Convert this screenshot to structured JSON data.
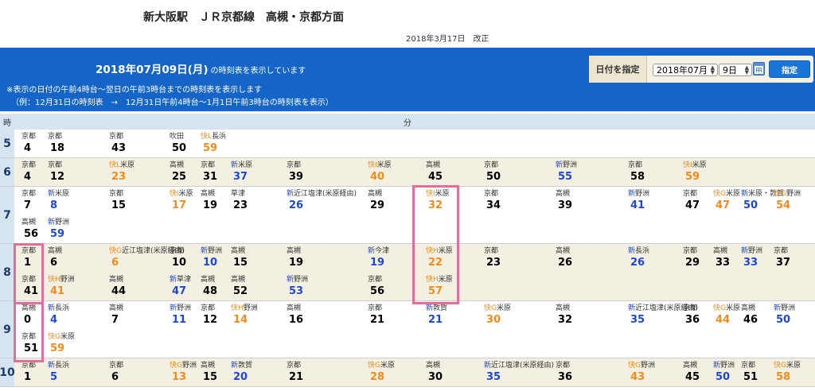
{
  "header": {
    "title": "新大阪駅　ＪＲ京都線　高槻・京都方面",
    "revised": "2018年3月17日　改正"
  },
  "banner": {
    "date_main": "2018年07月09日(月)",
    "date_suffix": "の時刻表を表示しています",
    "note1": "※表示の日付の午前4時台〜翌日の午前3時台までの時刻表を表示します",
    "note2": "（例：12月31日の時刻表　→　12月31日午前4時台〜1月1日午前3時台の時刻表を表示）"
  },
  "date_picker": {
    "label": "日付を指定",
    "month_value": "2018年07月",
    "day_value": "9日",
    "submit_label": "指定"
  },
  "table_header": {
    "hour": "時",
    "minute": "分"
  },
  "colors": {
    "banner_blue": "#1565c8",
    "rapid_orange": "#f08c1e",
    "new_rapid_blue": "#1e46d8",
    "highlight_pink": "#e0709a"
  },
  "timetable": [
    {
      "hour": "5",
      "trains": [
        {
          "pre": "",
          "dest": "京都",
          "min": "4",
          "type": "local"
        },
        {
          "pre": "",
          "dest": "京都",
          "min": "18",
          "type": "local"
        },
        {
          "pre": "",
          "dest": "京都",
          "min": "43",
          "type": "local"
        },
        {
          "pre": "",
          "dest": "吹田",
          "min": "50",
          "type": "local"
        },
        {
          "pre": "快L",
          "dest": "長浜",
          "min": "59",
          "type": "rapid"
        }
      ]
    },
    {
      "hour": "6",
      "trains": [
        {
          "pre": "",
          "dest": "京都",
          "min": "4",
          "type": "local"
        },
        {
          "pre": "",
          "dest": "京都",
          "min": "12",
          "type": "local"
        },
        {
          "pre": "快L",
          "dest": "米原",
          "min": "23",
          "type": "rapid"
        },
        {
          "pre": "",
          "dest": "高槻",
          "min": "25",
          "type": "local"
        },
        {
          "pre": "",
          "dest": "京都",
          "min": "31",
          "type": "local"
        },
        {
          "pre": "新",
          "dest": "米原",
          "min": "37",
          "type": "new"
        },
        {
          "pre": "",
          "dest": "京都",
          "min": "39",
          "type": "local"
        },
        {
          "pre": "快I",
          "dest": "米原",
          "min": "40",
          "type": "rapid"
        },
        {
          "pre": "",
          "dest": "高槻",
          "min": "45",
          "type": "local"
        },
        {
          "pre": "",
          "dest": "京都",
          "min": "50",
          "type": "local"
        },
        {
          "pre": "新",
          "dest": "野洲",
          "min": "55",
          "type": "new"
        },
        {
          "pre": "",
          "dest": "京都",
          "min": "58",
          "type": "local"
        },
        {
          "pre": "快I",
          "dest": "米原",
          "min": "59",
          "type": "rapid"
        }
      ]
    },
    {
      "hour": "7",
      "trains": [
        {
          "pre": "",
          "dest": "京都",
          "min": "7",
          "type": "local"
        },
        {
          "pre": "新",
          "dest": "米原",
          "min": "8",
          "type": "new"
        },
        {
          "pre": "",
          "dest": "京都",
          "min": "15",
          "type": "local"
        },
        {
          "pre": "快I",
          "dest": "米原",
          "min": "17",
          "type": "rapid"
        },
        {
          "pre": "",
          "dest": "高槻",
          "min": "19",
          "type": "local"
        },
        {
          "pre": "",
          "dest": "草津",
          "min": "23",
          "type": "local"
        },
        {
          "pre": "新",
          "dest": "近江塩津(米原経由)",
          "min": "26",
          "type": "new"
        },
        {
          "pre": "",
          "dest": "高槻",
          "min": "29",
          "type": "local"
        },
        {
          "pre": "快I",
          "dest": "米原",
          "min": "32",
          "type": "rapid"
        },
        {
          "pre": "",
          "dest": "京都",
          "min": "34",
          "type": "local"
        },
        {
          "pre": "",
          "dest": "高槻",
          "min": "39",
          "type": "local"
        },
        {
          "pre": "新",
          "dest": "野洲",
          "min": "41",
          "type": "new"
        },
        {
          "pre": "",
          "dest": "京都",
          "min": "47",
          "type": "local"
        },
        {
          "pre": "快G",
          "dest": "米原",
          "min": "47",
          "type": "rapid"
        },
        {
          "pre": "新",
          "dest": "米原・敦賀",
          "min": "50",
          "type": "new"
        },
        {
          "pre": "快G",
          "dest": "野洲",
          "min": "54",
          "type": "rapid"
        },
        {
          "pre": "",
          "dest": "高槻",
          "min": "56",
          "type": "local"
        },
        {
          "pre": "新",
          "dest": "野洲",
          "min": "59",
          "type": "new"
        }
      ]
    },
    {
      "hour": "8",
      "trains": [
        {
          "pre": "",
          "dest": "京都",
          "min": "1",
          "type": "local"
        },
        {
          "pre": "",
          "dest": "高槻",
          "min": "6",
          "type": "local"
        },
        {
          "pre": "快G",
          "dest": "近江塩津(米原経由)",
          "min": "6",
          "type": "rapid"
        },
        {
          "pre": "",
          "dest": "京都",
          "min": "10",
          "type": "local"
        },
        {
          "pre": "新",
          "dest": "野洲",
          "min": "10",
          "type": "new"
        },
        {
          "pre": "",
          "dest": "高槻",
          "min": "15",
          "type": "local"
        },
        {
          "pre": "",
          "dest": "高槻",
          "min": "19",
          "type": "local"
        },
        {
          "pre": "新",
          "dest": "今津",
          "min": "19",
          "type": "new"
        },
        {
          "pre": "快H",
          "dest": "米原",
          "min": "22",
          "type": "rapid"
        },
        {
          "pre": "",
          "dest": "京都",
          "min": "23",
          "type": "local"
        },
        {
          "pre": "",
          "dest": "高槻",
          "min": "26",
          "type": "local"
        },
        {
          "pre": "新",
          "dest": "長浜",
          "min": "26",
          "type": "new"
        },
        {
          "pre": "",
          "dest": "京都",
          "min": "29",
          "type": "local"
        },
        {
          "pre": "",
          "dest": "高槻",
          "min": "33",
          "type": "local"
        },
        {
          "pre": "新",
          "dest": "野洲",
          "min": "33",
          "type": "new"
        },
        {
          "pre": "",
          "dest": "京都",
          "min": "37",
          "type": "local"
        },
        {
          "pre": "",
          "dest": "京都",
          "min": "41",
          "type": "local"
        },
        {
          "pre": "快H",
          "dest": "野洲",
          "min": "41",
          "type": "rapid"
        },
        {
          "pre": "",
          "dest": "高槻",
          "min": "44",
          "type": "local"
        },
        {
          "pre": "新",
          "dest": "草津",
          "min": "47",
          "type": "new"
        },
        {
          "pre": "",
          "dest": "高槻",
          "min": "48",
          "type": "local"
        },
        {
          "pre": "",
          "dest": "高槻",
          "min": "52",
          "type": "local"
        },
        {
          "pre": "新",
          "dest": "野洲",
          "min": "53",
          "type": "new"
        },
        {
          "pre": "",
          "dest": "京都",
          "min": "56",
          "type": "local"
        },
        {
          "pre": "快H",
          "dest": "米原",
          "min": "57",
          "type": "rapid"
        }
      ]
    },
    {
      "hour": "9",
      "trains": [
        {
          "pre": "",
          "dest": "高槻",
          "min": "0",
          "type": "local"
        },
        {
          "pre": "新",
          "dest": "長浜",
          "min": "4",
          "type": "new"
        },
        {
          "pre": "",
          "dest": "高槻",
          "min": "7",
          "type": "local"
        },
        {
          "pre": "新",
          "dest": "野洲",
          "min": "11",
          "type": "new"
        },
        {
          "pre": "",
          "dest": "京都",
          "min": "12",
          "type": "local"
        },
        {
          "pre": "快H",
          "dest": "野洲",
          "min": "14",
          "type": "rapid"
        },
        {
          "pre": "",
          "dest": "高槻",
          "min": "16",
          "type": "local"
        },
        {
          "pre": "",
          "dest": "京都",
          "min": "21",
          "type": "local"
        },
        {
          "pre": "新",
          "dest": "敦賀",
          "min": "21",
          "type": "new"
        },
        {
          "pre": "快G",
          "dest": "米原",
          "min": "30",
          "type": "rapid"
        },
        {
          "pre": "",
          "dest": "高槻",
          "min": "32",
          "type": "local"
        },
        {
          "pre": "新",
          "dest": "近江塩津(米原経由)",
          "min": "35",
          "type": "new"
        },
        {
          "pre": "",
          "dest": "京都",
          "min": "36",
          "type": "local"
        },
        {
          "pre": "快G",
          "dest": "米原",
          "min": "44",
          "type": "rapid"
        },
        {
          "pre": "",
          "dest": "高槻",
          "min": "46",
          "type": "local"
        },
        {
          "pre": "新",
          "dest": "野洲",
          "min": "50",
          "type": "new"
        },
        {
          "pre": "",
          "dest": "京都",
          "min": "51",
          "type": "local"
        },
        {
          "pre": "快G",
          "dest": "米原",
          "min": "59",
          "type": "rapid"
        }
      ]
    },
    {
      "hour": "10",
      "trains": [
        {
          "pre": "",
          "dest": "京都",
          "min": "1",
          "type": "local"
        },
        {
          "pre": "新",
          "dest": "長浜",
          "min": "5",
          "type": "new"
        },
        {
          "pre": "",
          "dest": "京都",
          "min": "6",
          "type": "local"
        },
        {
          "pre": "快G",
          "dest": "野洲",
          "min": "13",
          "type": "rapid"
        },
        {
          "pre": "",
          "dest": "高槻",
          "min": "15",
          "type": "local"
        },
        {
          "pre": "新",
          "dest": "敦賀",
          "min": "20",
          "type": "new"
        },
        {
          "pre": "",
          "dest": "京都",
          "min": "21",
          "type": "local"
        },
        {
          "pre": "快G",
          "dest": "米原",
          "min": "28",
          "type": "rapid"
        },
        {
          "pre": "",
          "dest": "高槻",
          "min": "30",
          "type": "local"
        },
        {
          "pre": "新",
          "dest": "近江塩津(米原経由)",
          "min": "35",
          "type": "new"
        },
        {
          "pre": "",
          "dest": "京都",
          "min": "36",
          "type": "local"
        },
        {
          "pre": "快G",
          "dest": "野洲",
          "min": "43",
          "type": "rapid"
        },
        {
          "pre": "",
          "dest": "高槻",
          "min": "45",
          "type": "local"
        },
        {
          "pre": "新",
          "dest": "野洲",
          "min": "50",
          "type": "new"
        },
        {
          "pre": "",
          "dest": "京都",
          "min": "51",
          "type": "local"
        },
        {
          "pre": "快G",
          "dest": "米原",
          "min": "58",
          "type": "rapid"
        }
      ]
    }
  ]
}
